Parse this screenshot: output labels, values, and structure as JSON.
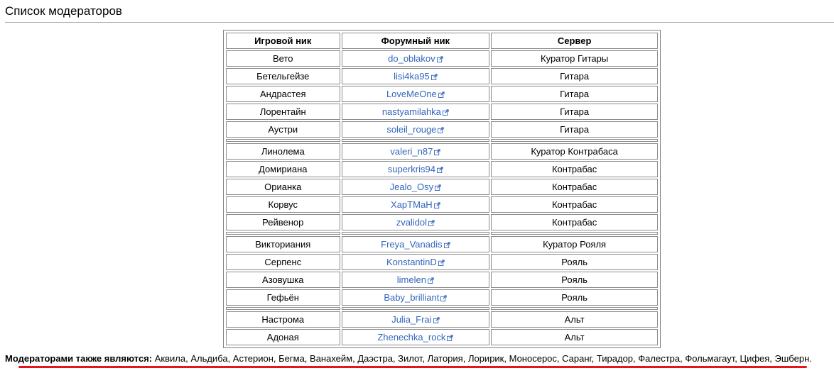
{
  "page": {
    "title": "Список модераторов"
  },
  "table": {
    "headers": [
      "Игровой ник",
      "Форумный ник",
      "Сервер"
    ],
    "groups": [
      [
        {
          "game": "Вето",
          "forum": "do_oblakov",
          "server": "Куратор Гитары"
        },
        {
          "game": "Бетельгейзе",
          "forum": "lisi4ka95",
          "server": "Гитара"
        },
        {
          "game": "Андрастея",
          "forum": "LoveMeOne",
          "server": "Гитара"
        },
        {
          "game": "Лорентайн",
          "forum": "nastyamilahka",
          "server": "Гитара"
        },
        {
          "game": "Аустри",
          "forum": "soleil_rouge",
          "server": "Гитара"
        }
      ],
      [
        {
          "game": "Линолема",
          "forum": "valeri_n87",
          "server": "Куратор Контрабаса"
        },
        {
          "game": "Домириана",
          "forum": "superkris94",
          "server": "Контрабас"
        },
        {
          "game": "Орианка",
          "forum": "Jealo_Osy",
          "server": "Контрабас"
        },
        {
          "game": "Корвус",
          "forum": "ХарТМаН",
          "server": "Контрабас"
        },
        {
          "game": "Рейвенор",
          "forum": "zvalidol",
          "server": "Контрабас"
        }
      ],
      [
        {
          "game": "Викториания",
          "forum": "Freya_Vanadis",
          "server": "Куратор Рояля"
        },
        {
          "game": "Серпенс",
          "forum": "KonstantinD",
          "server": "Рояль"
        },
        {
          "game": "Азовушка",
          "forum": "limelen",
          "server": "Рояль"
        },
        {
          "game": "Гефьён",
          "forum": "Baby_brilliant",
          "server": "Рояль"
        }
      ],
      [
        {
          "game": "Настрома",
          "forum": "Julia_Frai",
          "server": "Альт"
        },
        {
          "game": "Адоная",
          "forum": "Zhenechka_rock",
          "server": "Альт"
        }
      ]
    ]
  },
  "footer": {
    "label": "Модераторами также являются:",
    "text": " Аквила, Альдиба, Астерион, Бегма, Ванахейм, Даэстра, Зилот, Латория, Лоририк, Моносерос, Саранг, Тирадор, Фалестра, Фольмагаут, Цифея, Эшберн."
  },
  "colors": {
    "link": "#3366bb",
    "underline_annotation": "#e8141b"
  },
  "icons": {
    "external_link": "external-link-icon"
  }
}
